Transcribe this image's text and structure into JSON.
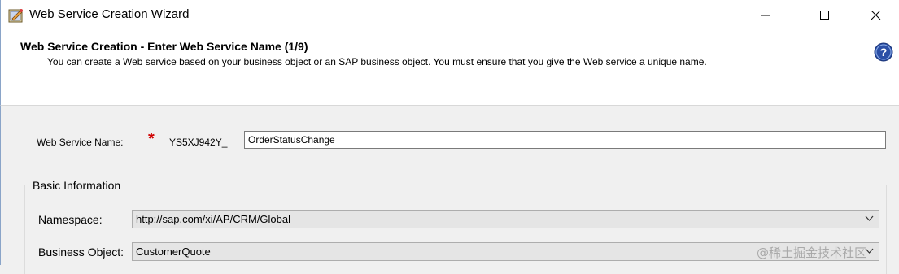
{
  "window": {
    "title": "Web Service Creation Wizard"
  },
  "header": {
    "title": "Web Service Creation - Enter Web Service Name (1/9)",
    "description": "You can create a Web service based on your business object or an SAP business object. You must ensure that you give the Web service a unique name."
  },
  "form": {
    "web_service_name_label": "Web Service Name:",
    "required_marker": "*",
    "name_prefix": "YS5XJ942Y_",
    "web_service_name_value": "OrderStatusChange",
    "basic_info_title": "Basic Information",
    "namespace_label": "Namespace:",
    "namespace_value": "http://sap.com/xi/AP/CRM/Global",
    "business_object_label": "Business Object:",
    "business_object_value": "CustomerQuote"
  },
  "watermark": "@稀土掘金技术社区",
  "colors": {
    "required": "#d00000",
    "help_icon": "#2b4fa6"
  }
}
